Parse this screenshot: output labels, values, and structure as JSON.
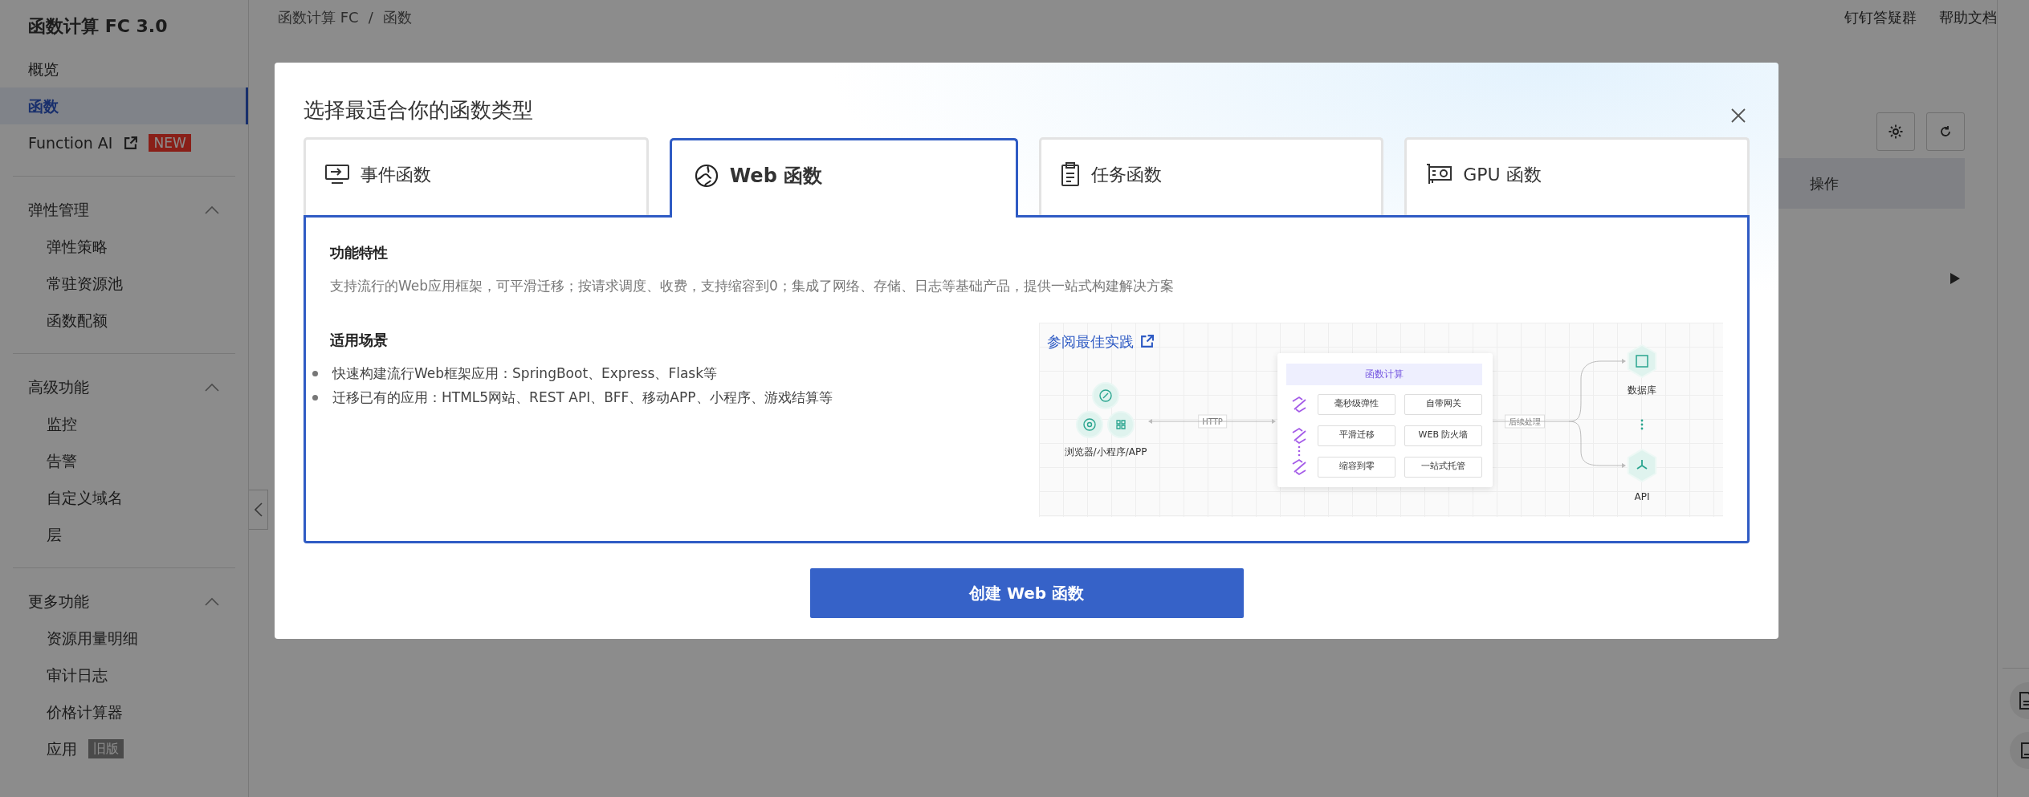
{
  "sidebar": {
    "title": "函数计算 FC 3.0",
    "items": [
      {
        "label": "概览",
        "selected": false
      },
      {
        "label": "函数",
        "selected": true
      },
      {
        "label": "Function AI",
        "external": true,
        "badge": "NEW",
        "selected": false
      }
    ],
    "groups": [
      {
        "label": "弹性管理",
        "expanded": true,
        "items": [
          {
            "label": "弹性策略"
          },
          {
            "label": "常驻资源池"
          },
          {
            "label": "函数配额"
          }
        ]
      },
      {
        "label": "高级功能",
        "expanded": true,
        "items": [
          {
            "label": "监控"
          },
          {
            "label": "告警"
          },
          {
            "label": "自定义域名"
          },
          {
            "label": "层"
          }
        ]
      },
      {
        "label": "更多功能",
        "expanded": true,
        "items": [
          {
            "label": "资源用量明细"
          },
          {
            "label": "审计日志"
          },
          {
            "label": "价格计算器"
          },
          {
            "label": "应用",
            "badge": "旧版"
          }
        ]
      }
    ]
  },
  "breadcrumb": [
    "函数计算 FC",
    "函数"
  ],
  "breadcrumb_separator": "/",
  "header_links": [
    "钉钉答疑群",
    "帮助文档"
  ],
  "table": {
    "columns": [
      "操作"
    ]
  },
  "modal": {
    "title": "选择最适合你的函数类型",
    "tabs": [
      {
        "label": "事件函数",
        "selected": false
      },
      {
        "label": "Web 函数",
        "selected": true
      },
      {
        "label": "任务函数",
        "selected": false
      },
      {
        "label": "GPU 函数",
        "selected": false
      }
    ],
    "features_heading": "功能特性",
    "features_text": "支持流行的Web应用框架，可平滑迁移；按请求调度、收费，支持缩容到0；集成了网络、存储、日志等基础产品，提供一站式构建解决方案",
    "scenarios_heading": "适用场景",
    "scenarios": [
      "快速构建流行Web框架应用：SpringBoot、Express、Flask等",
      "迁移已有的应用：HTML5网站、REST API、BFF、移动APP、小程序、游戏结算等"
    ],
    "diagram": {
      "link": "参阅最佳实践",
      "client_label": "浏览器/小程序/APP",
      "protocol": "HTTP",
      "core_title": "函数计算",
      "features": [
        "毫秒级弹性",
        "自带网关",
        "平滑迁移",
        "WEB 防火墙",
        "缩容到零",
        "一站式托管"
      ],
      "post_label": "后续处理",
      "targets": [
        "数据库",
        "API"
      ]
    },
    "create_button": "创建 Web 函数"
  }
}
